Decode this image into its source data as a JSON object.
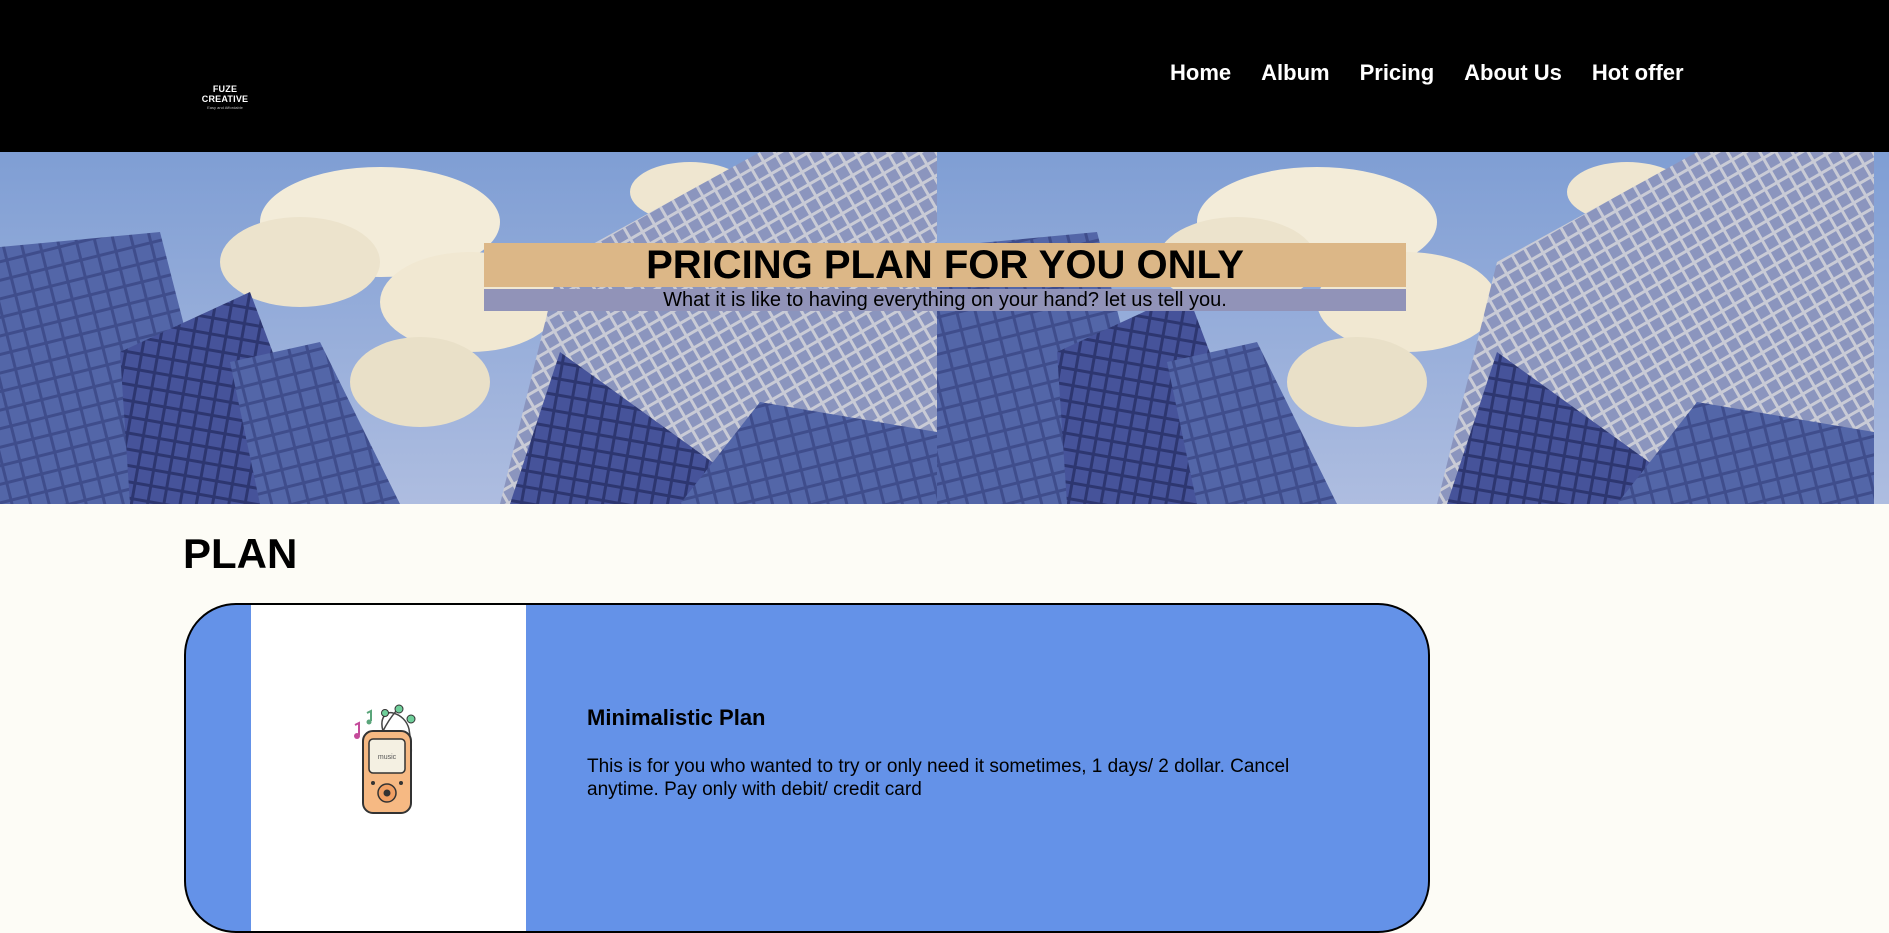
{
  "header": {
    "logo": {
      "title": "FUZE CREATIVE",
      "tagline": "Easy and Affordable"
    },
    "nav": [
      {
        "label": "Home"
      },
      {
        "label": "Album"
      },
      {
        "label": "Pricing"
      },
      {
        "label": "About Us"
      },
      {
        "label": "Hot offer"
      }
    ]
  },
  "hero": {
    "title": "PRICING PLAN FOR YOU ONLY",
    "subtitle": "What it is like to having everything on your hand? let us tell you.",
    "title_bg": "#dcb787",
    "subtitle_bg": "#9193b8"
  },
  "plans": {
    "section_title": "PLAN",
    "card_color": "#6492e8",
    "items": [
      {
        "name": "Minimalistic Plan",
        "description": "This is for you who wanted to try or only need it sometimes, 1 days/ 2 dollar. Cancel anytime. Pay only with debit/ credit card",
        "icon": "music-player-icon",
        "device_label": "music"
      }
    ]
  }
}
